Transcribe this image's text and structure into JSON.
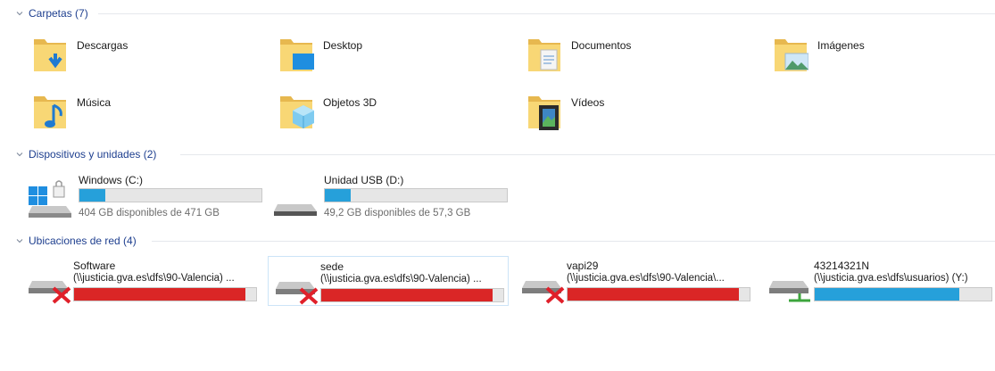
{
  "colors": {
    "header": "#1e3f8f",
    "bar_blue": "#26a0da",
    "bar_red": "#da2626",
    "bar_bg": "#e6e6e6"
  },
  "groups": {
    "folders": {
      "title": "Carpetas (7)"
    },
    "devices": {
      "title": "Dispositivos y unidades (2)"
    },
    "network": {
      "title": "Ubicaciones de red (4)"
    }
  },
  "folders": [
    {
      "label": "Descargas",
      "icon": "downloads-folder-icon"
    },
    {
      "label": "Desktop",
      "icon": "desktop-folder-icon"
    },
    {
      "label": "Documentos",
      "icon": "documents-folder-icon"
    },
    {
      "label": "Imágenes",
      "icon": "pictures-folder-icon"
    },
    {
      "label": "Música",
      "icon": "music-folder-icon"
    },
    {
      "label": "Objetos 3D",
      "icon": "3d-objects-folder-icon"
    },
    {
      "label": "Vídeos",
      "icon": "videos-folder-icon"
    }
  ],
  "drives": [
    {
      "name": "Windows (C:)",
      "space": "404 GB disponibles de 471 GB",
      "used_fraction": 0.142,
      "icon": "windows-drive-icon"
    },
    {
      "name": "Unidad USB (D:)",
      "space": "49,2 GB disponibles de 57,3 GB",
      "used_fraction": 0.141,
      "icon": "usb-drive-icon"
    }
  ],
  "network": [
    {
      "name": "Software",
      "path": "(\\\\justicia.gva.es\\dfs\\90-Valencia) ...",
      "used_fraction": 0.94,
      "status": "disconnected",
      "icon": "disconnected-network-drive-icon"
    },
    {
      "name": "sede",
      "path": "(\\\\justicia.gva.es\\dfs\\90-Valencia) ...",
      "used_fraction": 0.94,
      "status": "disconnected",
      "icon": "disconnected-network-drive-icon"
    },
    {
      "name": "vapi29",
      "path": "(\\\\justicia.gva.es\\dfs\\90-Valencia\\...",
      "used_fraction": 0.94,
      "status": "disconnected",
      "icon": "disconnected-network-drive-icon"
    },
    {
      "name": "43214321N",
      "path": "(\\\\justicia.gva.es\\dfs\\usuarios) (Y:)",
      "used_fraction": 0.82,
      "status": "connected",
      "icon": "network-drive-icon"
    }
  ]
}
